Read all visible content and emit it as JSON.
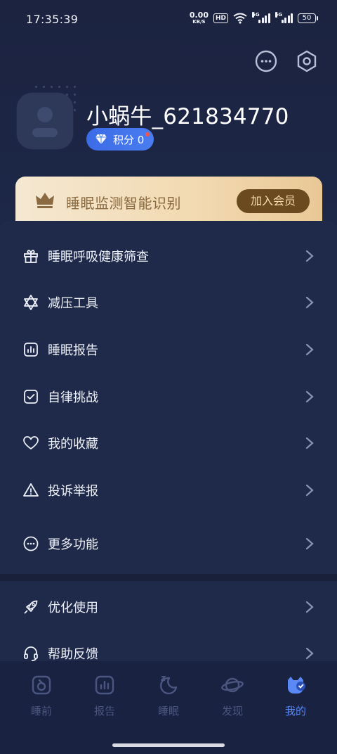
{
  "status_bar": {
    "time": "17:35:39",
    "net_speed": "0.00",
    "net_unit": "KB/S",
    "hd": "HD",
    "sig1": "5G",
    "sig2": "5G",
    "battery": "50"
  },
  "header": {
    "message_icon": "chat-bubble-icon",
    "settings_icon": "hexagon-gear-icon"
  },
  "profile": {
    "username": "小蜗牛_621834770",
    "points_label": "积分 0"
  },
  "vip_banner": {
    "text": "睡眠监测智能识别",
    "button": "加入会员",
    "colors": {
      "bg": "#f2d9b0",
      "button": "#6b4a20"
    }
  },
  "menu": {
    "items": [
      {
        "label": "睡眠呼吸健康筛查",
        "icon": "gift-icon"
      },
      {
        "label": "减压工具",
        "icon": "star-of-david-icon"
      },
      {
        "label": "睡眠报告",
        "icon": "bar-chart-icon"
      },
      {
        "label": "自律挑战",
        "icon": "checkbox-icon"
      },
      {
        "label": "我的收藏",
        "icon": "heart-icon"
      },
      {
        "label": "投诉举报",
        "icon": "warning-icon"
      },
      {
        "label": "更多功能",
        "icon": "more-circle-icon"
      }
    ],
    "items2": [
      {
        "label": "优化使用",
        "icon": "rocket-icon"
      },
      {
        "label": "帮助反馈",
        "icon": "headset-icon"
      }
    ]
  },
  "tabbar": {
    "tabs": [
      {
        "label": "睡前",
        "icon": "pre-sleep-icon"
      },
      {
        "label": "报告",
        "icon": "report-icon"
      },
      {
        "label": "睡眠",
        "icon": "moon-icon"
      },
      {
        "label": "发现",
        "icon": "planet-icon"
      },
      {
        "label": "我的",
        "icon": "mine-icon",
        "active": true
      }
    ],
    "colors": {
      "active": "#5a88f5",
      "inactive": "#4a5680"
    }
  }
}
